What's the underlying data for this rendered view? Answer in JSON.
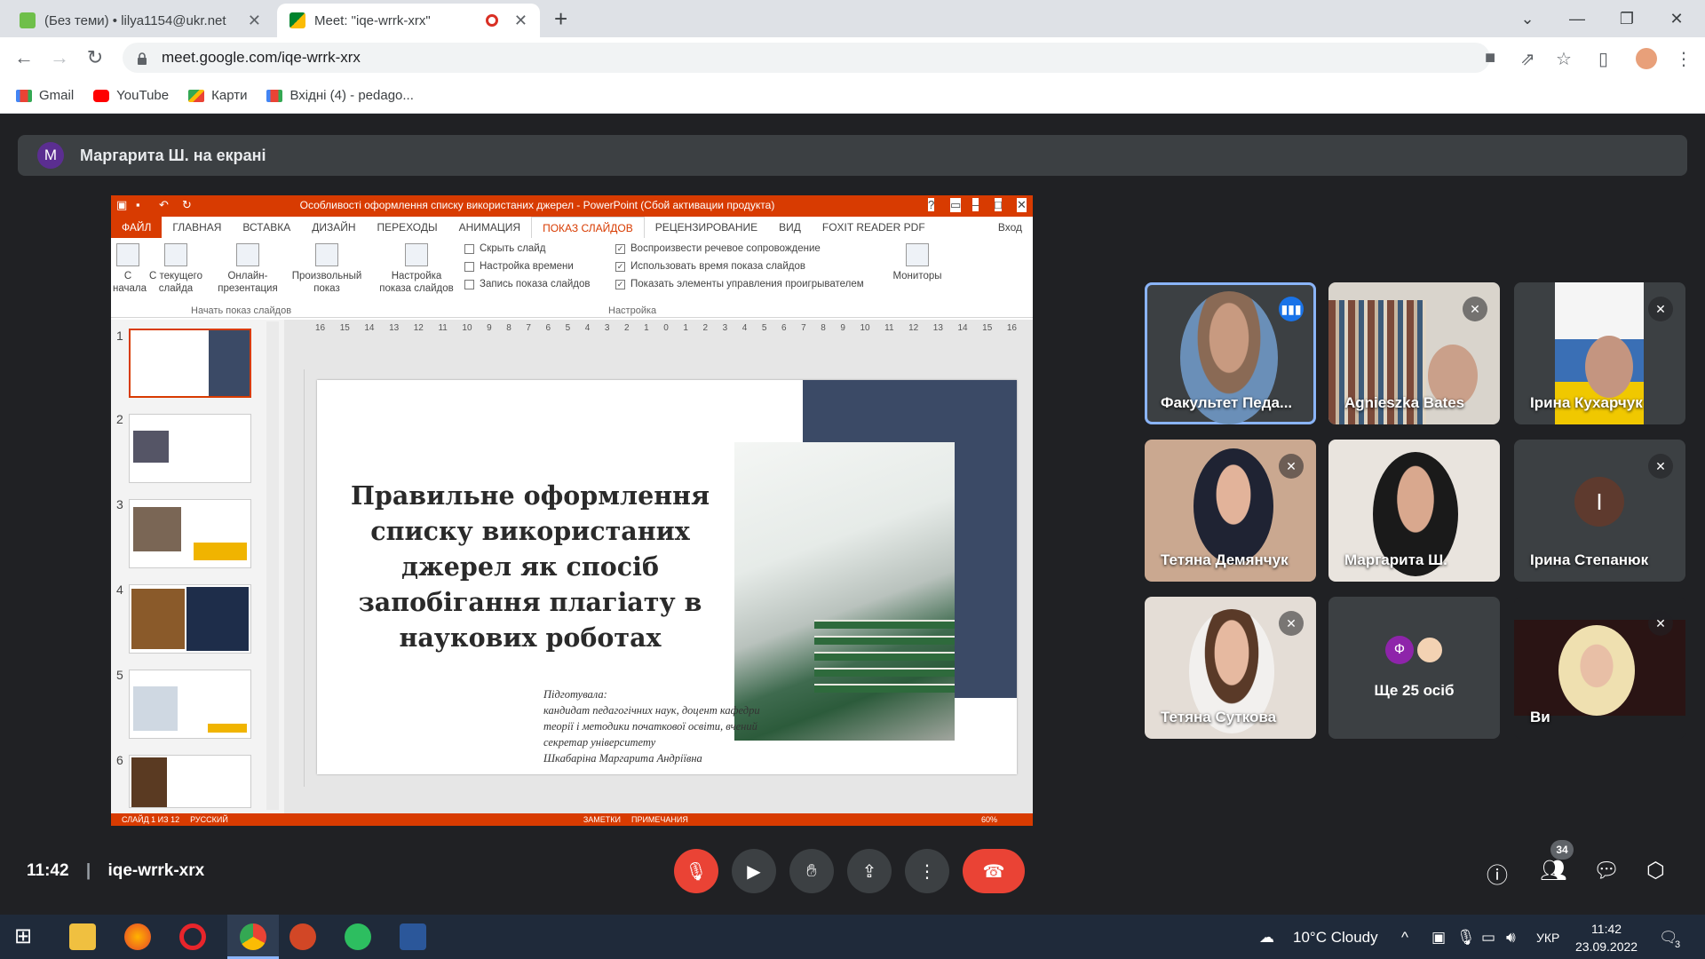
{
  "browser": {
    "tabs": [
      {
        "title": "(Без теми) • lilya1154@ukr.net",
        "active": false
      },
      {
        "title": "Meet: \"iqe-wrrk-xrx\"",
        "active": true
      }
    ],
    "url": "meet.google.com/iqe-wrrk-xrx",
    "bookmarks": [
      "Gmail",
      "YouTube",
      "Карти",
      "Вхідні (4) - pedago..."
    ]
  },
  "meet": {
    "presenter_initial": "M",
    "presenter_banner": "Маргарита Ш. на екрані",
    "participants": [
      {
        "name": "Факультет Педа...",
        "mic": "speaking"
      },
      {
        "name": "Agnieszka Bates",
        "mic": "muted"
      },
      {
        "name": "Ірина Кухарчук",
        "mic": "muted"
      },
      {
        "name": "Тетяна Демянчук",
        "mic": "muted"
      },
      {
        "name": "Маргарита Ш.",
        "mic": "on"
      },
      {
        "name": "Ірина Степанюк",
        "mic": "muted",
        "initial": "І"
      },
      {
        "name": "Тетяна Суткова",
        "mic": "muted"
      },
      {
        "name": "Ще 25 осіб",
        "mic": "none",
        "initial": "Ф"
      },
      {
        "name": "Ви",
        "mic": "muted"
      }
    ],
    "bottom": {
      "time": "11:42",
      "meeting_code": "iqe-wrrk-xrx",
      "people_count": "34"
    }
  },
  "powerpoint": {
    "title": "Особливості оформлення списку використаних джерел - PowerPoint (Сбой активации продукта)",
    "tabs": [
      "ФАЙЛ",
      "ГЛАВНАЯ",
      "ВСТАВКА",
      "ДИЗАЙН",
      "ПЕРЕХОДЫ",
      "АНИМАЦИЯ",
      "ПОКАЗ СЛАЙДОВ",
      "РЕЦЕНЗИРОВАНИЕ",
      "ВИД",
      "FOXIT READER PDF"
    ],
    "signin": "Вход",
    "ribbon": {
      "b1": "С\nначала",
      "b2": "С текущего\nслайда",
      "b3": "Онлайн-\nпрезентация",
      "b4": "Произвольный\nпоказ",
      "b5": "Настройка\nпоказа слайдов",
      "small": [
        "Скрыть слайд",
        "Настройка времени",
        "Запись показа слайдов"
      ],
      "checks": [
        "Воспроизвести речевое сопровождение",
        "Использовать время показа слайдов",
        "Показать элементы управления проигрывателем"
      ],
      "monitors": "Мониторы",
      "group1": "Начать показ слайдов",
      "group2": "Настройка"
    },
    "slide_numbers": [
      "1",
      "2",
      "3",
      "4",
      "5",
      "6"
    ],
    "ruler": [
      "16",
      "15",
      "14",
      "13",
      "12",
      "11",
      "10",
      "9",
      "8",
      "7",
      "6",
      "5",
      "4",
      "3",
      "2",
      "1",
      "0",
      "1",
      "2",
      "3",
      "4",
      "5",
      "6",
      "7",
      "8",
      "9",
      "10",
      "11",
      "12",
      "13",
      "14",
      "15",
      "16"
    ],
    "slide": {
      "heading": "Правильне оформлення списку використаних джерел як спосіб запобігання плагіату в наукових роботах",
      "author_lines": [
        "Підготувала:",
        "кандидат педагогічних наук, доцент кафедри",
        "теорії і методики початкової освіти, вчений",
        "секретар університету",
        "Шкабаріна Маргарита Андріївна"
      ]
    },
    "status": [
      "СЛАЙД 1 ИЗ 12",
      "РУССКИЙ",
      "ЗАМЕТКИ",
      "ПРИМЕЧАНИЯ",
      "60%"
    ]
  },
  "taskbar": {
    "weather": "10°C  Cloudy",
    "lang": "УКР",
    "time": "11:42",
    "date": "23.09.2022",
    "notif": "3"
  },
  "colors": {
    "ppt_accent": "#d83b01",
    "meet_bg": "#202124",
    "end_call": "#ea4335",
    "speaking": "#1a73e8"
  }
}
